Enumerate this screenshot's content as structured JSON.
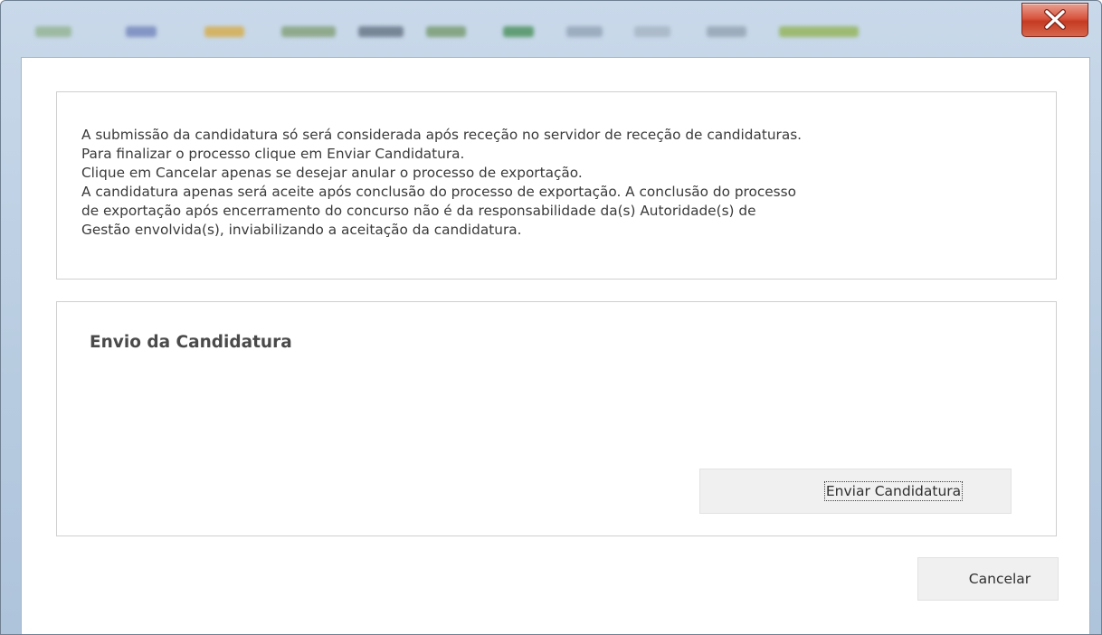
{
  "window": {
    "close_label": "Close",
    "titlebar_color": "#b7cbe0",
    "close_button_color": "#d9553f"
  },
  "info": {
    "lines": [
      "A submissão da candidatura só será considerada após receção no servidor de receção de candidaturas.",
      "Para finalizar o processo clique em Enviar Candidatura.",
      "Clique em Cancelar apenas se desejar anular o processo de exportação.",
      "A candidatura apenas será aceite após conclusão do processo de exportação. A conclusão do processo",
      "de exportação após encerramento do concurso não é da responsabilidade da(s) Autoridade(s) de",
      "Gestão envolvida(s), inviabilizando a aceitação da candidatura."
    ]
  },
  "send_section": {
    "title": "Envio da Candidatura",
    "send_button_label": "Enviar Candidatura"
  },
  "footer": {
    "cancel_label": "Cancelar"
  },
  "icons": {
    "close": "close-icon"
  }
}
